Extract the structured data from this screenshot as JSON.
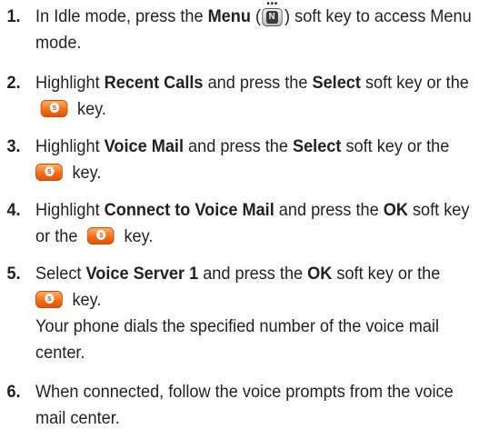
{
  "steps": [
    {
      "num": "1.",
      "a": "In Idle mode, press the ",
      "b": "Menu",
      "c": " (",
      "d": ") soft key to access Menu mode."
    },
    {
      "num": "2.",
      "a": "Highlight ",
      "b": "Recent Calls",
      "c": " and press the ",
      "d": "Select",
      "e": " soft key or the ",
      "f": " key."
    },
    {
      "num": "3.",
      "a": "Highlight ",
      "b": "Voice Mail",
      "c": " and press the ",
      "d": "Select",
      "e": " soft key or the ",
      "f": " key."
    },
    {
      "num": "4.",
      "a": "Highlight ",
      "b": "Connect to Voice Mail",
      "c": " and press the ",
      "d": "OK",
      "e": " soft key or the ",
      "f": " key."
    },
    {
      "num": "5.",
      "a": "Select ",
      "b": "Voice Server 1",
      "c": " and press the ",
      "d": "OK",
      "e": " soft key or the ",
      "f": " key.",
      "g": "Your phone dials the specified number of the voice mail center."
    },
    {
      "num": "6.",
      "a": "When connected, follow the voice prompts from the voice mail center."
    }
  ],
  "icons": {
    "menu_key": "menu-key-icon",
    "ok_key": "ok-key-icon",
    "menu_key_glyph": "N",
    "ok_key_glyph": "s",
    "menu_key_dots": "•••",
    "ok_key_color": "#f26b11"
  }
}
